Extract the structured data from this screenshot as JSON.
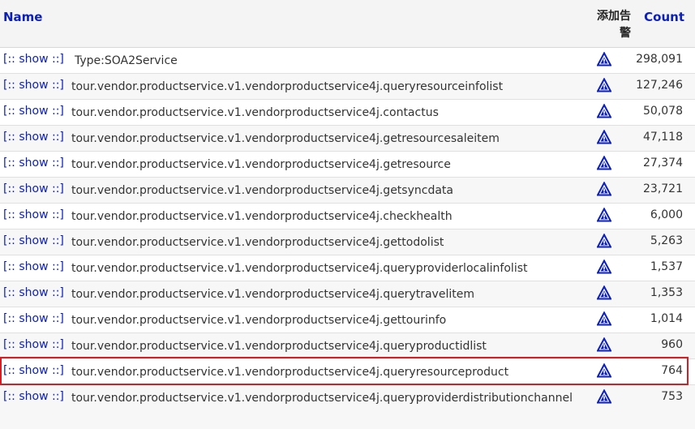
{
  "header": {
    "name_label": "Name",
    "alert_label": "添加告警",
    "count_label": "Count"
  },
  "show_label": "[:: show ::]",
  "alert_icon": "warning-triangle-icon",
  "link_color": "#0b1fbd",
  "highlight_color": "#d32027",
  "rows": [
    {
      "name": "Type:SOA2Service",
      "count": "298,091"
    },
    {
      "name": "tour.vendor.productservice.v1.vendorproductservice4j.queryresourceinfolist",
      "count": "127,246"
    },
    {
      "name": "tour.vendor.productservice.v1.vendorproductservice4j.contactus",
      "count": "50,078"
    },
    {
      "name": "tour.vendor.productservice.v1.vendorproductservice4j.getresourcesaleitem",
      "count": "47,118"
    },
    {
      "name": "tour.vendor.productservice.v1.vendorproductservice4j.getresource",
      "count": "27,374"
    },
    {
      "name": "tour.vendor.productservice.v1.vendorproductservice4j.getsyncdata",
      "count": "23,721"
    },
    {
      "name": "tour.vendor.productservice.v1.vendorproductservice4j.checkhealth",
      "count": "6,000"
    },
    {
      "name": "tour.vendor.productservice.v1.vendorproductservice4j.gettodolist",
      "count": "5,263"
    },
    {
      "name": "tour.vendor.productservice.v1.vendorproductservice4j.queryproviderlocalinfolist",
      "count": "1,537"
    },
    {
      "name": "tour.vendor.productservice.v1.vendorproductservice4j.querytravelitem",
      "count": "1,353"
    },
    {
      "name": "tour.vendor.productservice.v1.vendorproductservice4j.gettourinfo",
      "count": "1,014"
    },
    {
      "name": "tour.vendor.productservice.v1.vendorproductservice4j.queryproductidlist",
      "count": "960"
    },
    {
      "name": "tour.vendor.productservice.v1.vendorproductservice4j.queryresourceproduct",
      "count": "764"
    },
    {
      "name": "tour.vendor.productservice.v1.vendorproductservice4j.queryproviderdistributionchannel",
      "count": "753"
    }
  ]
}
